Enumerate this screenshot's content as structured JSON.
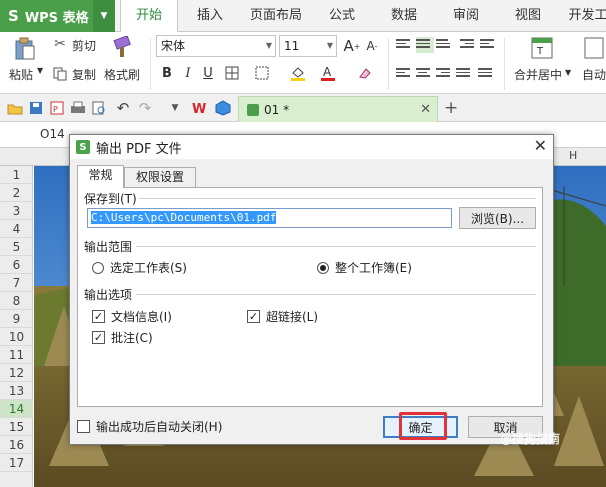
{
  "app": {
    "name": "WPS 表格",
    "logo": "S"
  },
  "tabs": [
    "开始",
    "插入",
    "页面布局",
    "公式",
    "数据",
    "审阅",
    "视图",
    "开发工"
  ],
  "ribbon": {
    "paste": "粘贴",
    "cut": "剪切",
    "copy": "复制",
    "format_painter": "格式刷",
    "font_name": "宋体",
    "font_size": "11",
    "merge_center": "合并居中",
    "auto_wrap": "自动"
  },
  "quick_access": {
    "doc_tab": "01 *"
  },
  "formula_bar": {
    "cell_ref": "O14"
  },
  "sheet": {
    "col_letter": "H",
    "rows": [
      "1",
      "2",
      "3",
      "4",
      "5",
      "6",
      "7",
      "8",
      "9",
      "10",
      "11",
      "12",
      "13",
      "14",
      "15",
      "16",
      "17"
    ],
    "selected_row": "14"
  },
  "dialog": {
    "title": "输出 PDF 文件",
    "tab_general": "常规",
    "tab_permissions": "权限设置",
    "save_to_label": "保存到(T)",
    "save_path": "C:\\Users\\pc\\Documents\\01.pdf",
    "browse": "浏览(B)...",
    "range_label": "输出范围",
    "range_selected": "选定工作表(S)",
    "range_workbook": "整个工作簿(E)",
    "options_label": "输出选项",
    "opt_doc_info": "文档信息(I)",
    "opt_hyperlink": "超链接(L)",
    "opt_comments": "批注(C)",
    "auto_close": "输出成功后自动关闭(H)",
    "ok": "确定",
    "cancel": "取消"
  },
  "watermark": "@搜狗指南",
  "colors": {
    "brand_green": "#4b9f4b",
    "highlight_red": "#e0343a"
  }
}
